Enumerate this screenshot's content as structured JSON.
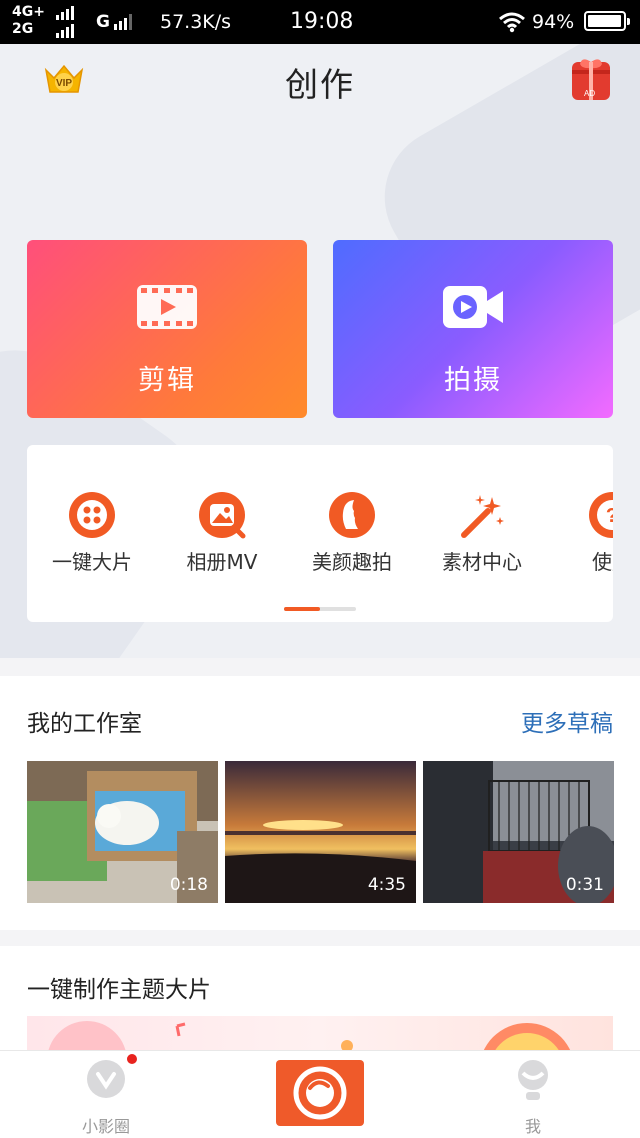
{
  "status_bar": {
    "net_top": "4G+",
    "net_bottom": "2G",
    "net_g": "G",
    "speed": "57.3K/s",
    "time": "19:08",
    "battery": "94%"
  },
  "header": {
    "title": "创作",
    "vip_badge": "VIP",
    "ad_badge": "AD"
  },
  "actions": {
    "edit_label": "剪辑",
    "shoot_label": "拍摄"
  },
  "tools": [
    {
      "label": "一键大片",
      "icon": "film-reel-icon"
    },
    {
      "label": "相册MV",
      "icon": "album-mv-icon"
    },
    {
      "label": "美颜趣拍",
      "icon": "beauty-face-icon"
    },
    {
      "label": "素材中心",
      "icon": "magic-wand-icon"
    },
    {
      "label": "使用",
      "icon": "help-icon"
    }
  ],
  "studio": {
    "title": "我的工作室",
    "more": "更多草稿",
    "items": [
      {
        "duration": "0:18"
      },
      {
        "duration": "4:35"
      },
      {
        "duration": "0:31"
      }
    ]
  },
  "theme": {
    "title": "一键制作主题大片"
  },
  "bottom_nav": {
    "left_label": "小影圈",
    "right_label": "我"
  },
  "colors": {
    "accent": "#f15a24",
    "link": "#2d6fb8",
    "edit_gradient_start": "#ff4f7b",
    "edit_gradient_end": "#ff8a2a",
    "shoot_gradient_start": "#4f6cff",
    "shoot_gradient_end": "#f36bff"
  }
}
